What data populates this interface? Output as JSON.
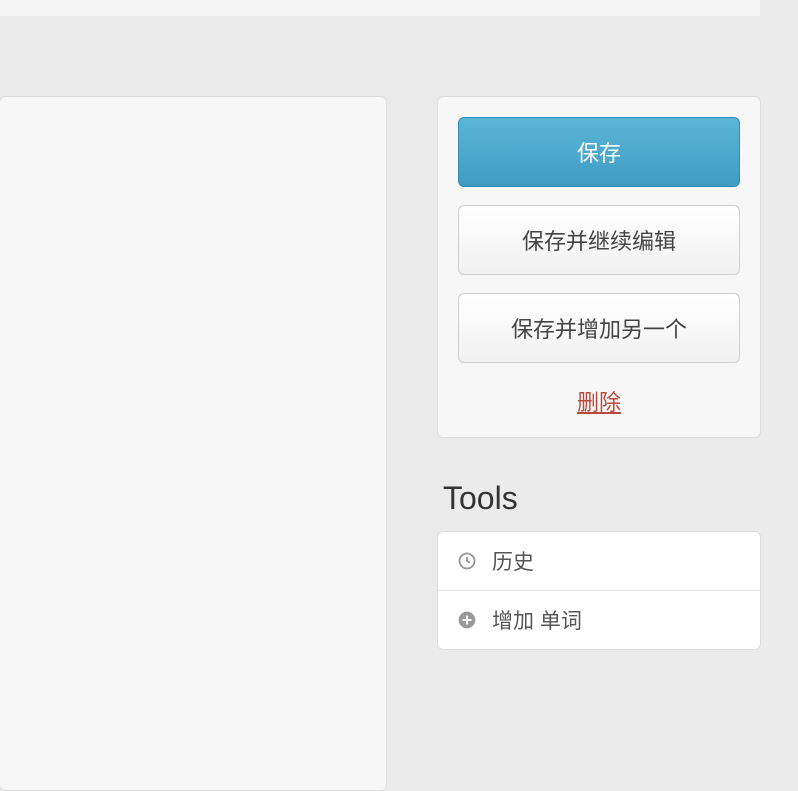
{
  "actions": {
    "save": "保存",
    "save_continue": "保存并继续编辑",
    "save_add_another": "保存并增加另一个",
    "delete": "删除"
  },
  "tools": {
    "heading": "Tools",
    "items": [
      {
        "icon": "clock-icon",
        "label": "历史"
      },
      {
        "icon": "plus-circle-icon",
        "label": "增加 单词"
      }
    ]
  }
}
